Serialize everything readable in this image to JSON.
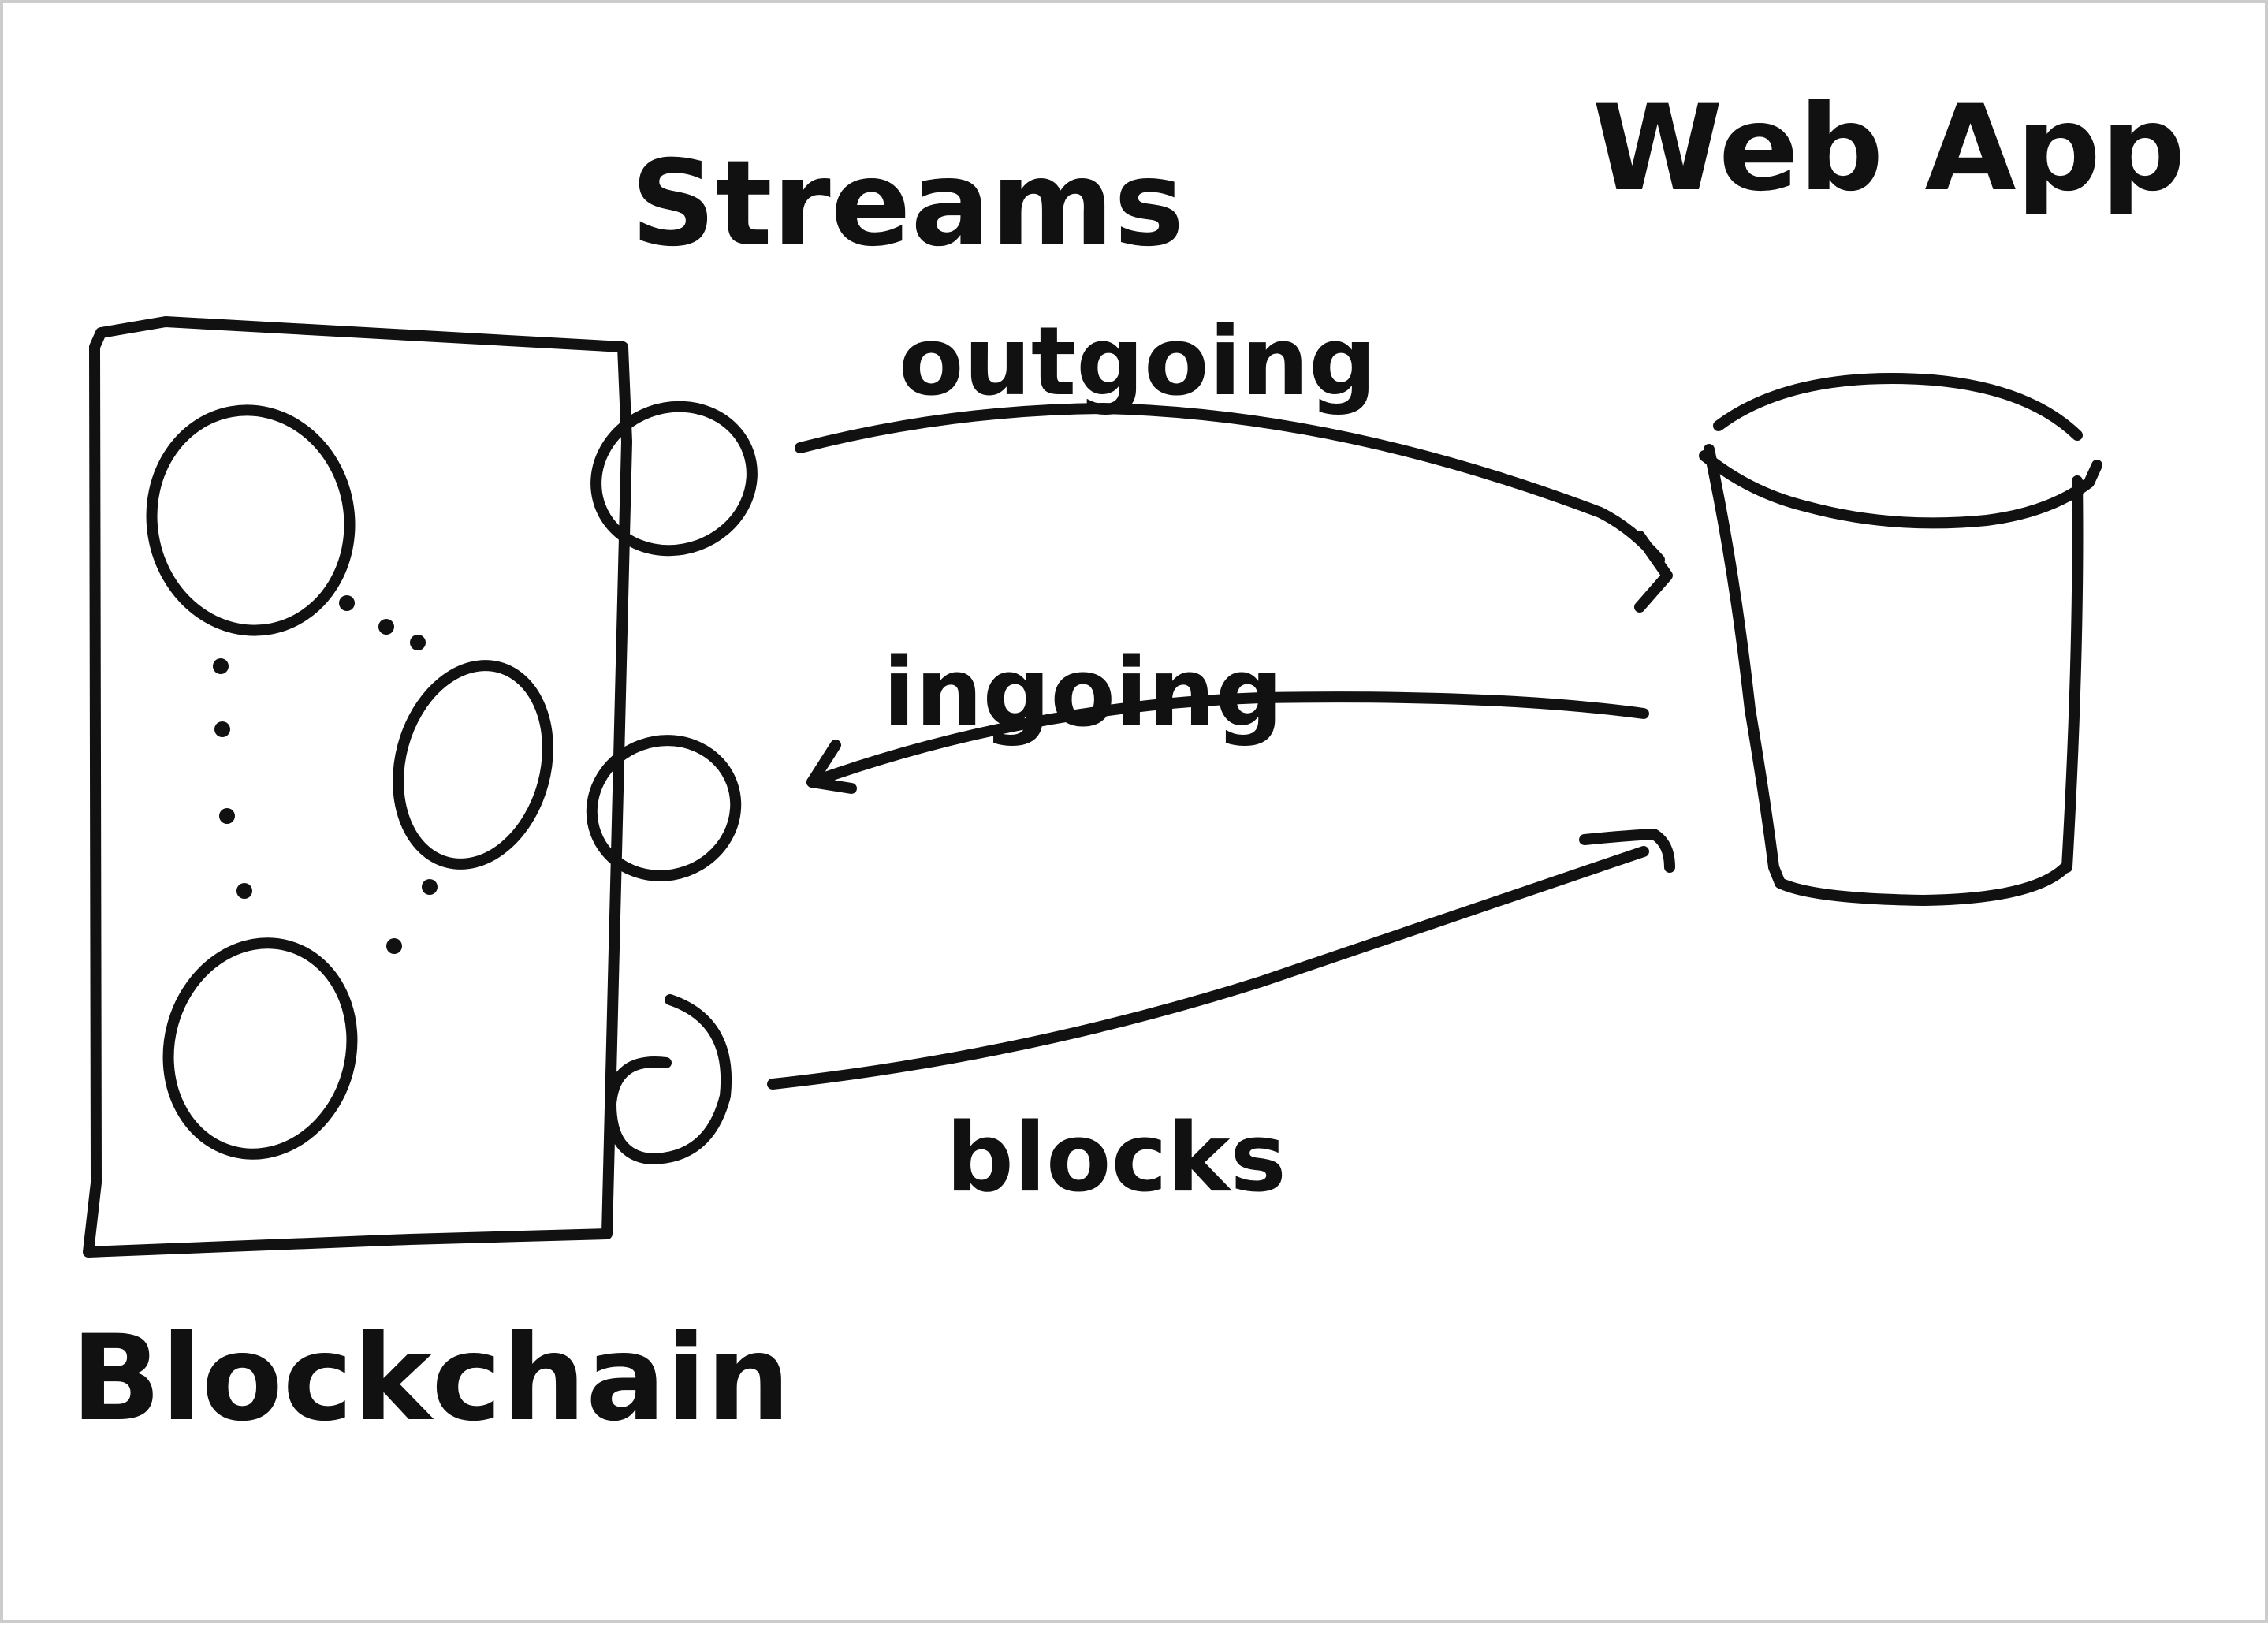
{
  "diagram": {
    "title_streams": "Streams",
    "title_webapp": "Web App",
    "title_blockchain": "Blockchain",
    "edge_outgoing": "outgoing",
    "edge_ingoing": "ingoing",
    "edge_blocks": "blocks"
  },
  "colors": {
    "ink": "#111111",
    "paper": "#ffffff"
  }
}
